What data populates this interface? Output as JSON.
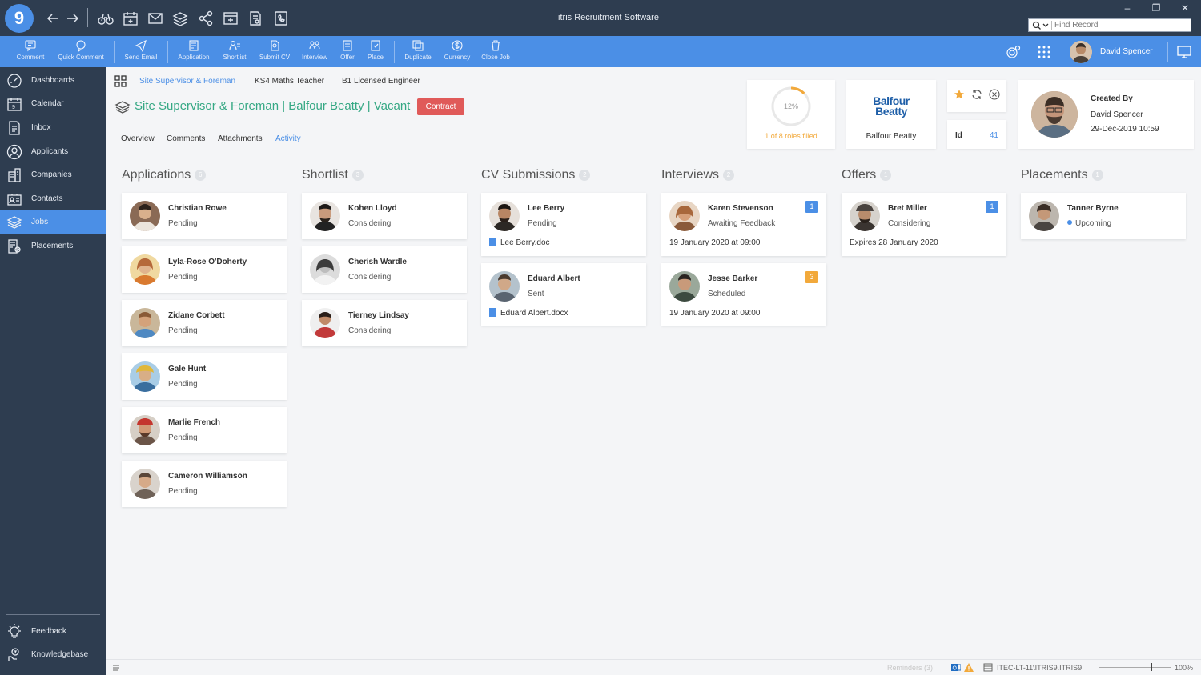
{
  "app": {
    "logo_text": "9",
    "title": "itris Recruitment Software",
    "find_placeholder": "Find Record",
    "toolbar_icons": [
      "back-arrow-icon",
      "forward-arrow-icon",
      "binoculars-icon",
      "calendar-plus-icon",
      "envelope-icon",
      "stack-icon",
      "share-icon",
      "new-window-icon",
      "document-gear-icon",
      "phone-document-icon"
    ]
  },
  "ribbon": {
    "buttons": [
      {
        "label": "Comment",
        "icon": "comment-icon"
      },
      {
        "label": "Quick Comment",
        "icon": "quick-comment-icon"
      },
      {
        "label": "Send Email",
        "icon": "send-email-icon"
      },
      {
        "label": "Application",
        "icon": "application-icon"
      },
      {
        "label": "Shortlist",
        "icon": "shortlist-icon"
      },
      {
        "label": "Submit CV",
        "icon": "submit-cv-icon"
      },
      {
        "label": "Interview",
        "icon": "interview-icon"
      },
      {
        "label": "Offer",
        "icon": "offer-icon"
      },
      {
        "label": "Place",
        "icon": "place-icon"
      },
      {
        "label": "Duplicate",
        "icon": "duplicate-icon"
      },
      {
        "label": "Currency",
        "icon": "currency-icon"
      },
      {
        "label": "Close Job",
        "icon": "close-job-icon"
      }
    ],
    "user_name": "David Spencer"
  },
  "sidebar": {
    "items": [
      {
        "label": "Dashboards",
        "icon": "dashboard-icon",
        "active": false
      },
      {
        "label": "Calendar",
        "icon": "calendar-icon",
        "active": false
      },
      {
        "label": "Inbox",
        "icon": "inbox-icon",
        "active": false
      },
      {
        "label": "Applicants",
        "icon": "applicants-icon",
        "active": false
      },
      {
        "label": "Companies",
        "icon": "companies-icon",
        "active": false
      },
      {
        "label": "Contacts",
        "icon": "contacts-icon",
        "active": false
      },
      {
        "label": "Jobs",
        "icon": "jobs-icon",
        "active": true
      },
      {
        "label": "Placements",
        "icon": "placements-icon",
        "active": false
      }
    ],
    "bottom_items": [
      {
        "label": "Feedback",
        "icon": "feedback-icon"
      },
      {
        "label": "Knowledgebase",
        "icon": "knowledgebase-icon"
      }
    ]
  },
  "record_tabs": [
    {
      "label": "Site Supervisor & Foreman",
      "active": true
    },
    {
      "label": "KS4 Maths Teacher",
      "active": false
    },
    {
      "label": "B1 Licensed Engineer",
      "active": false
    }
  ],
  "job": {
    "title": "Site Supervisor & Foreman | Balfour Beatty | Vacant",
    "type_badge": "Contract"
  },
  "sub_tabs": [
    {
      "label": "Overview",
      "active": false
    },
    {
      "label": "Comments",
      "active": false
    },
    {
      "label": "Attachments",
      "active": false
    },
    {
      "label": "Activity",
      "active": true
    }
  ],
  "info": {
    "progress_pct_label": "12%",
    "progress_fraction": 0.125,
    "roles_filled": "1 of 8 roles filled",
    "company_logo_line1": "Balfour",
    "company_logo_line2": "Beatty",
    "company_name": "Balfour Beatty",
    "id_label": "Id",
    "id_value": "41",
    "created_by_label": "Created By",
    "created_by_name": "David Spencer",
    "created_date": "29-Dec-2019 10:59"
  },
  "colors": {
    "accent": "#4b8fe6",
    "sidebar_bg": "#2e3d50",
    "title_green": "#35a884",
    "contract_red": "#e05a59",
    "badge_orange": "#f2a93b"
  },
  "pipeline": {
    "columns": [
      {
        "title": "Applications",
        "count": "6",
        "cards": [
          {
            "name": "Christian Rowe",
            "status": "Pending",
            "avatar_color": "#8a6a55"
          },
          {
            "name": "Lyla-Rose O'Doherty",
            "status": "Pending",
            "avatar_color": "#c98a5a"
          },
          {
            "name": "Zidane Corbett",
            "status": "Pending",
            "avatar_color": "#b07a58"
          },
          {
            "name": "Gale Hunt",
            "status": "Pending",
            "avatar_color": "#7fa0b8"
          },
          {
            "name": "Marlie French",
            "status": "Pending",
            "avatar_color": "#a36a4c"
          },
          {
            "name": "Cameron Williamson",
            "status": "Pending",
            "avatar_color": "#9c8472"
          }
        ]
      },
      {
        "title": "Shortlist",
        "count": "3",
        "cards": [
          {
            "name": "Kohen Lloyd",
            "status": "Considering",
            "avatar_color": "#6b5a50"
          },
          {
            "name": "Cherish Wardle",
            "status": "Considering",
            "avatar_color": "#9a9a9a"
          },
          {
            "name": "Tierney Lindsay",
            "status": "Considering",
            "avatar_color": "#c23a3a"
          }
        ]
      },
      {
        "title": "CV Submissions",
        "count": "2",
        "cards": [
          {
            "name": "Lee Berry",
            "status": "Pending",
            "doc": "Lee Berry.doc",
            "avatar_color": "#4a3c34"
          },
          {
            "name": "Eduard Albert",
            "status": "Sent",
            "doc": "Eduard Albert.docx",
            "avatar_color": "#7a8590"
          }
        ]
      },
      {
        "title": "Interviews",
        "count": "2",
        "cards": [
          {
            "name": "Karen Stevenson",
            "status": "Awaiting Feedback",
            "extra": "19 January 2020 at 09:00",
            "badge": "1",
            "badge_color": "#4b8fe6",
            "avatar_color": "#b5784e"
          },
          {
            "name": "Jesse Barker",
            "status": "Scheduled",
            "extra": "19 January 2020 at 09:00",
            "badge": "3",
            "badge_color": "#f2a93b",
            "avatar_color": "#5c6b60"
          }
        ]
      },
      {
        "title": "Offers",
        "count": "1",
        "cards": [
          {
            "name": "Bret Miller",
            "status": "Considering",
            "extra": "Expires 28 January 2020",
            "badge": "1",
            "badge_color": "#4b8fe6",
            "avatar_color": "#5a5048"
          }
        ]
      },
      {
        "title": "Placements",
        "count": "1",
        "cards": [
          {
            "name": "Tanner Byrne",
            "status": "Upcoming",
            "dot": true,
            "avatar_color": "#6a6058"
          }
        ]
      }
    ]
  },
  "statusbar": {
    "reminders": "Reminders (3)",
    "server": "ITEC-LT-11\\ITRIS9.ITRIS9",
    "zoom": "100%"
  }
}
